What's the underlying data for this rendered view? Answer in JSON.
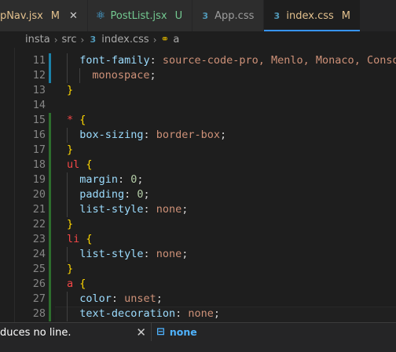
{
  "tabs": [
    {
      "name": "opNav.jsx",
      "badge": "M",
      "close": "✕",
      "icon": "react-icon",
      "state": "modified"
    },
    {
      "name": "PostList.jsx",
      "badge": "U",
      "icon": "react-icon",
      "state": "untracked"
    },
    {
      "name": "App.css",
      "icon": "css-icon",
      "state": "normal"
    },
    {
      "name": "index.css",
      "badge": "M",
      "icon": "css-icon",
      "state": "active"
    }
  ],
  "breadcrumb": {
    "parts": [
      "insta",
      "src",
      "index.css",
      "a"
    ]
  },
  "editor": {
    "lines": [
      {
        "num": "11",
        "tokens": [
          [
            "prop",
            "font-family"
          ],
          [
            "punct",
            ": "
          ],
          [
            "val",
            "source-code-pro, Menlo, Monaco, Consolas"
          ]
        ],
        "indent": 1
      },
      {
        "num": "12",
        "tokens": [
          [
            "val",
            "monospace"
          ],
          [
            "punct",
            ";"
          ]
        ],
        "indent": 2
      },
      {
        "num": "13",
        "tokens": [
          [
            "brace",
            "}"
          ]
        ],
        "indent": 0
      },
      {
        "num": "14",
        "tokens": [],
        "indent": 0
      },
      {
        "num": "15",
        "tokens": [
          [
            "kw",
            "*"
          ],
          [
            "punct",
            " "
          ],
          [
            "brace",
            "{"
          ]
        ],
        "indent": 0
      },
      {
        "num": "16",
        "tokens": [
          [
            "prop",
            "box-sizing"
          ],
          [
            "punct",
            ": "
          ],
          [
            "val",
            "border-box"
          ],
          [
            "punct",
            ";"
          ]
        ],
        "indent": 1
      },
      {
        "num": "17",
        "tokens": [
          [
            "brace",
            "}"
          ]
        ],
        "indent": 0
      },
      {
        "num": "18",
        "tokens": [
          [
            "kw",
            "ul"
          ],
          [
            "punct",
            " "
          ],
          [
            "brace",
            "{"
          ]
        ],
        "indent": 0
      },
      {
        "num": "19",
        "tokens": [
          [
            "prop",
            "margin"
          ],
          [
            "punct",
            ": "
          ],
          [
            "num",
            "0"
          ],
          [
            "punct",
            ";"
          ]
        ],
        "indent": 1
      },
      {
        "num": "20",
        "tokens": [
          [
            "prop",
            "padding"
          ],
          [
            "punct",
            ": "
          ],
          [
            "num",
            "0"
          ],
          [
            "punct",
            ";"
          ]
        ],
        "indent": 1
      },
      {
        "num": "21",
        "tokens": [
          [
            "prop",
            "list-style"
          ],
          [
            "punct",
            ": "
          ],
          [
            "val",
            "none"
          ],
          [
            "punct",
            ";"
          ]
        ],
        "indent": 1
      },
      {
        "num": "22",
        "tokens": [
          [
            "brace",
            "}"
          ]
        ],
        "indent": 0
      },
      {
        "num": "23",
        "tokens": [
          [
            "kw",
            "li"
          ],
          [
            "punct",
            " "
          ],
          [
            "brace",
            "{"
          ]
        ],
        "indent": 0
      },
      {
        "num": "24",
        "tokens": [
          [
            "prop",
            "list-style"
          ],
          [
            "punct",
            ": "
          ],
          [
            "val",
            "none"
          ],
          [
            "punct",
            ";"
          ]
        ],
        "indent": 1
      },
      {
        "num": "25",
        "tokens": [
          [
            "brace",
            "}"
          ]
        ],
        "indent": 0
      },
      {
        "num": "26",
        "tokens": [
          [
            "kw",
            "a"
          ],
          [
            "punct",
            " "
          ],
          [
            "brace",
            "{"
          ]
        ],
        "indent": 0
      },
      {
        "num": "27",
        "tokens": [
          [
            "prop",
            "color"
          ],
          [
            "punct",
            ": "
          ],
          [
            "val",
            "unset"
          ],
          [
            "punct",
            ";"
          ]
        ],
        "indent": 1
      },
      {
        "num": "28",
        "tokens": [
          [
            "prop",
            "text-decoration"
          ],
          [
            "punct",
            ": "
          ],
          [
            "val",
            "none"
          ],
          [
            "punct",
            ";"
          ]
        ],
        "indent": 1
      }
    ]
  },
  "notification": {
    "text": "duces no line.",
    "close": "✕"
  },
  "suggestion": {
    "text": "none"
  },
  "colors": {
    "accent": "#3794ff",
    "modified": "#e2c08d",
    "untracked": "#73c991"
  }
}
